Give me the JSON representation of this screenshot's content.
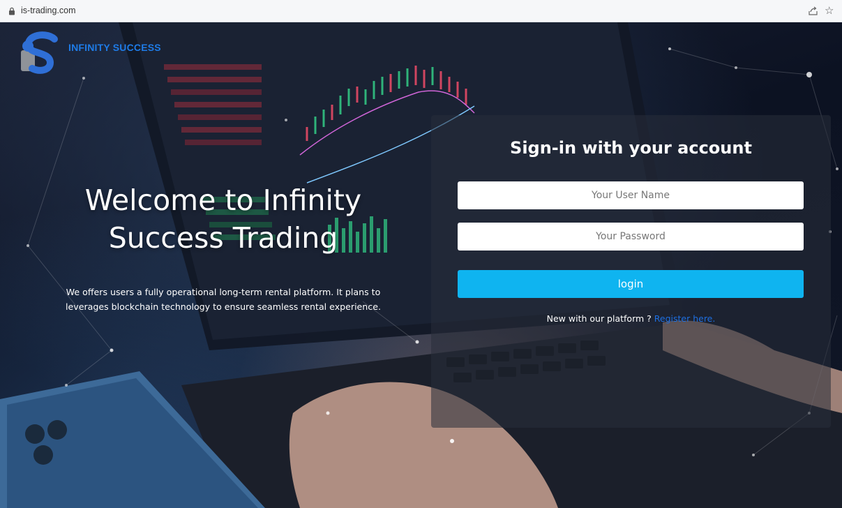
{
  "browser": {
    "url": "is-trading.com"
  },
  "brand": {
    "name": "INFINITY SUCCESS",
    "color": "#1e7be6"
  },
  "hero": {
    "title_line1": "Welcome to Infinity",
    "title_line2": "Success Trading",
    "subtitle_line1": "We offers users a fully operational long-term rental platform. It plans to",
    "subtitle_line2": "leverages blockchain technology to ensure seamless rental experience."
  },
  "login": {
    "title": "Sign-in with your account",
    "username_placeholder": "Your User Name",
    "password_placeholder": "Your Password",
    "button_label": "login",
    "register_prompt": "New with our platform ?",
    "register_link": "Register here.",
    "button_color": "#0fb4f0"
  },
  "icons": {
    "address_lock": "lock-icon",
    "share": "share-icon",
    "bookmark": "star-icon",
    "logo": "infinity-s-logo"
  }
}
